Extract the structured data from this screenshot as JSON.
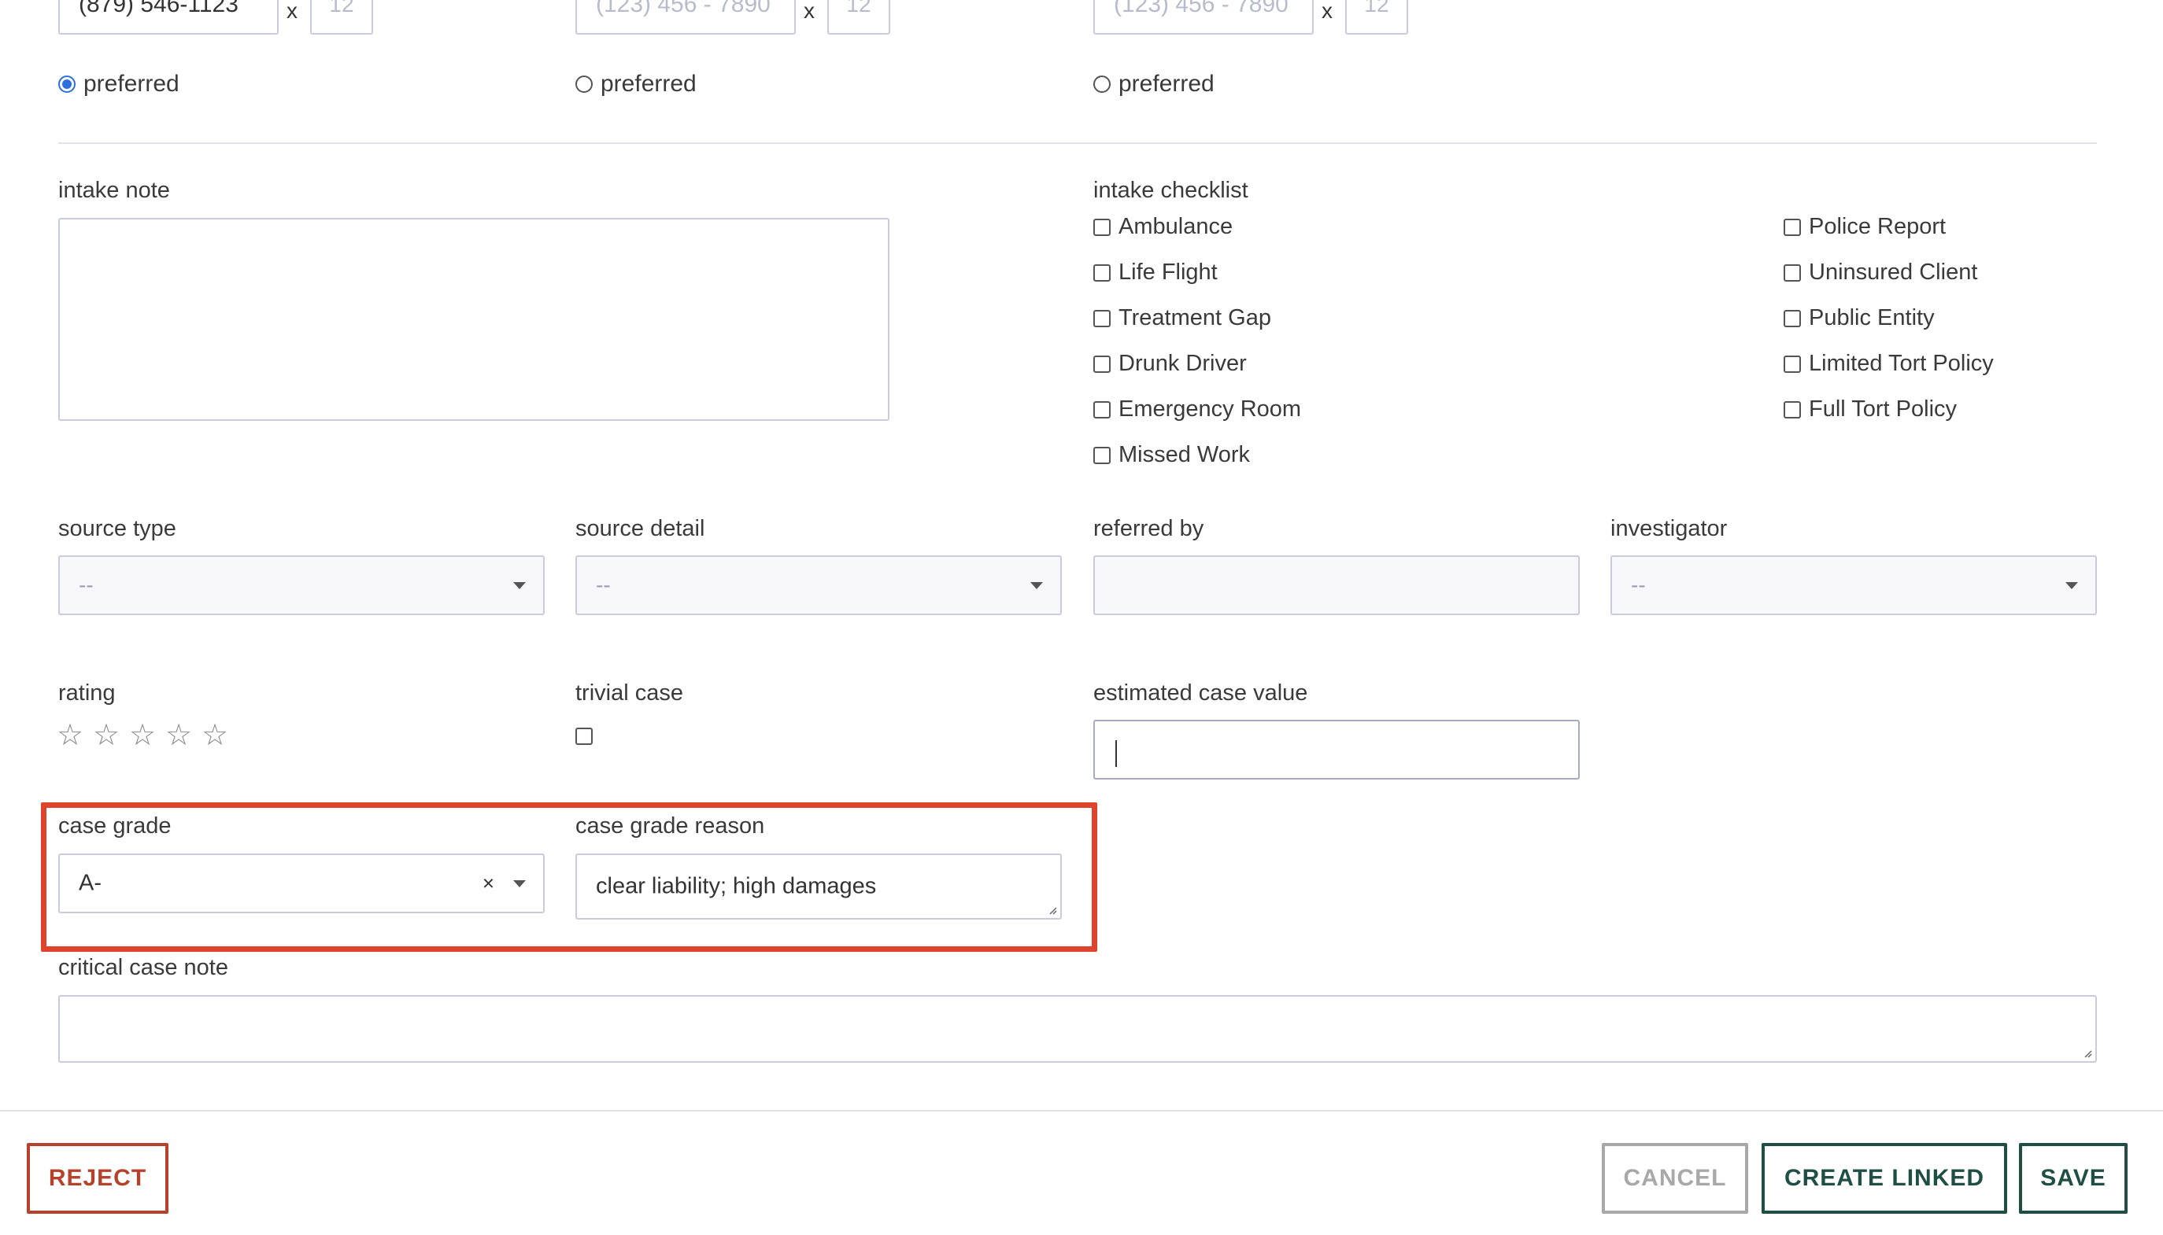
{
  "phones": [
    {
      "value": "(879) 546-1123",
      "placeholder": "",
      "ext_placeholder": "12",
      "x_label": "x",
      "radio_label": "preferred",
      "preferred": true
    },
    {
      "value": "",
      "placeholder": "(123) 456 - 7890",
      "ext_placeholder": "12",
      "x_label": "x",
      "radio_label": "preferred",
      "preferred": false
    },
    {
      "value": "",
      "placeholder": "(123) 456 - 7890",
      "ext_placeholder": "12",
      "x_label": "x",
      "radio_label": "preferred",
      "preferred": false
    }
  ],
  "intake_note": {
    "label": "intake note",
    "value": ""
  },
  "intake_checklist": {
    "label": "intake checklist",
    "left": [
      "Ambulance",
      "Life Flight",
      "Treatment Gap",
      "Drunk Driver",
      "Emergency Room",
      "Missed Work"
    ],
    "right": [
      "Police Report",
      "Uninsured Client",
      "Public Entity",
      "Limited Tort Policy",
      "Full Tort Policy"
    ]
  },
  "source_type": {
    "label": "source type",
    "value": "--"
  },
  "source_detail": {
    "label": "source detail",
    "value": "--"
  },
  "referred_by": {
    "label": "referred by",
    "value": ""
  },
  "investigator": {
    "label": "investigator",
    "value": "--"
  },
  "rating": {
    "label": "rating",
    "value": 0,
    "max": 5
  },
  "trivial_case": {
    "label": "trivial case",
    "checked": false
  },
  "estimated_case_value": {
    "label": "estimated case value",
    "value": ""
  },
  "case_grade": {
    "label": "case grade",
    "value": "A-",
    "clear_glyph": "×"
  },
  "case_grade_reason": {
    "label": "case grade reason",
    "value": "clear liability; high damages"
  },
  "critical_case_note": {
    "label": "critical case note",
    "value": ""
  },
  "highlight_color": "#e0432b",
  "buttons": {
    "reject": "REJECT",
    "cancel": "CANCEL",
    "create_linked": "CREATE LINKED",
    "save": "SAVE"
  },
  "colors": {
    "reject": "#b5432c",
    "cancel": "#a8a8a8",
    "primary": "#1f4e45"
  }
}
